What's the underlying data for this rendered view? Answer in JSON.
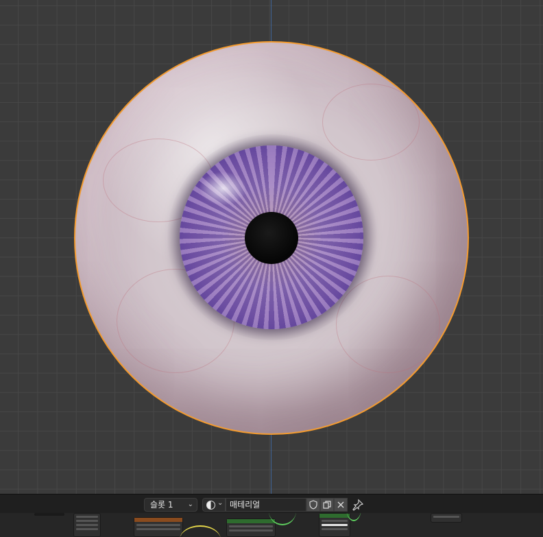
{
  "viewport": {
    "object": "eyeball-mesh",
    "selection_outline_color": "#f39a2d",
    "iris_color": "#7859ad",
    "grid_color": "#474747",
    "axis_color": "#3f6aa6"
  },
  "material_header": {
    "slot_label": "슬롯 1",
    "material_name": "매테리얼",
    "icons": {
      "browse": "material-sphere-icon",
      "fake_user": "shield-icon",
      "duplicate": "copy-icon",
      "unlink": "close-icon",
      "pin": "pin-icon"
    }
  },
  "node_editor": {
    "wire_colors": {
      "yellow": "#e6d84a",
      "green": "#5fcf5f"
    }
  }
}
